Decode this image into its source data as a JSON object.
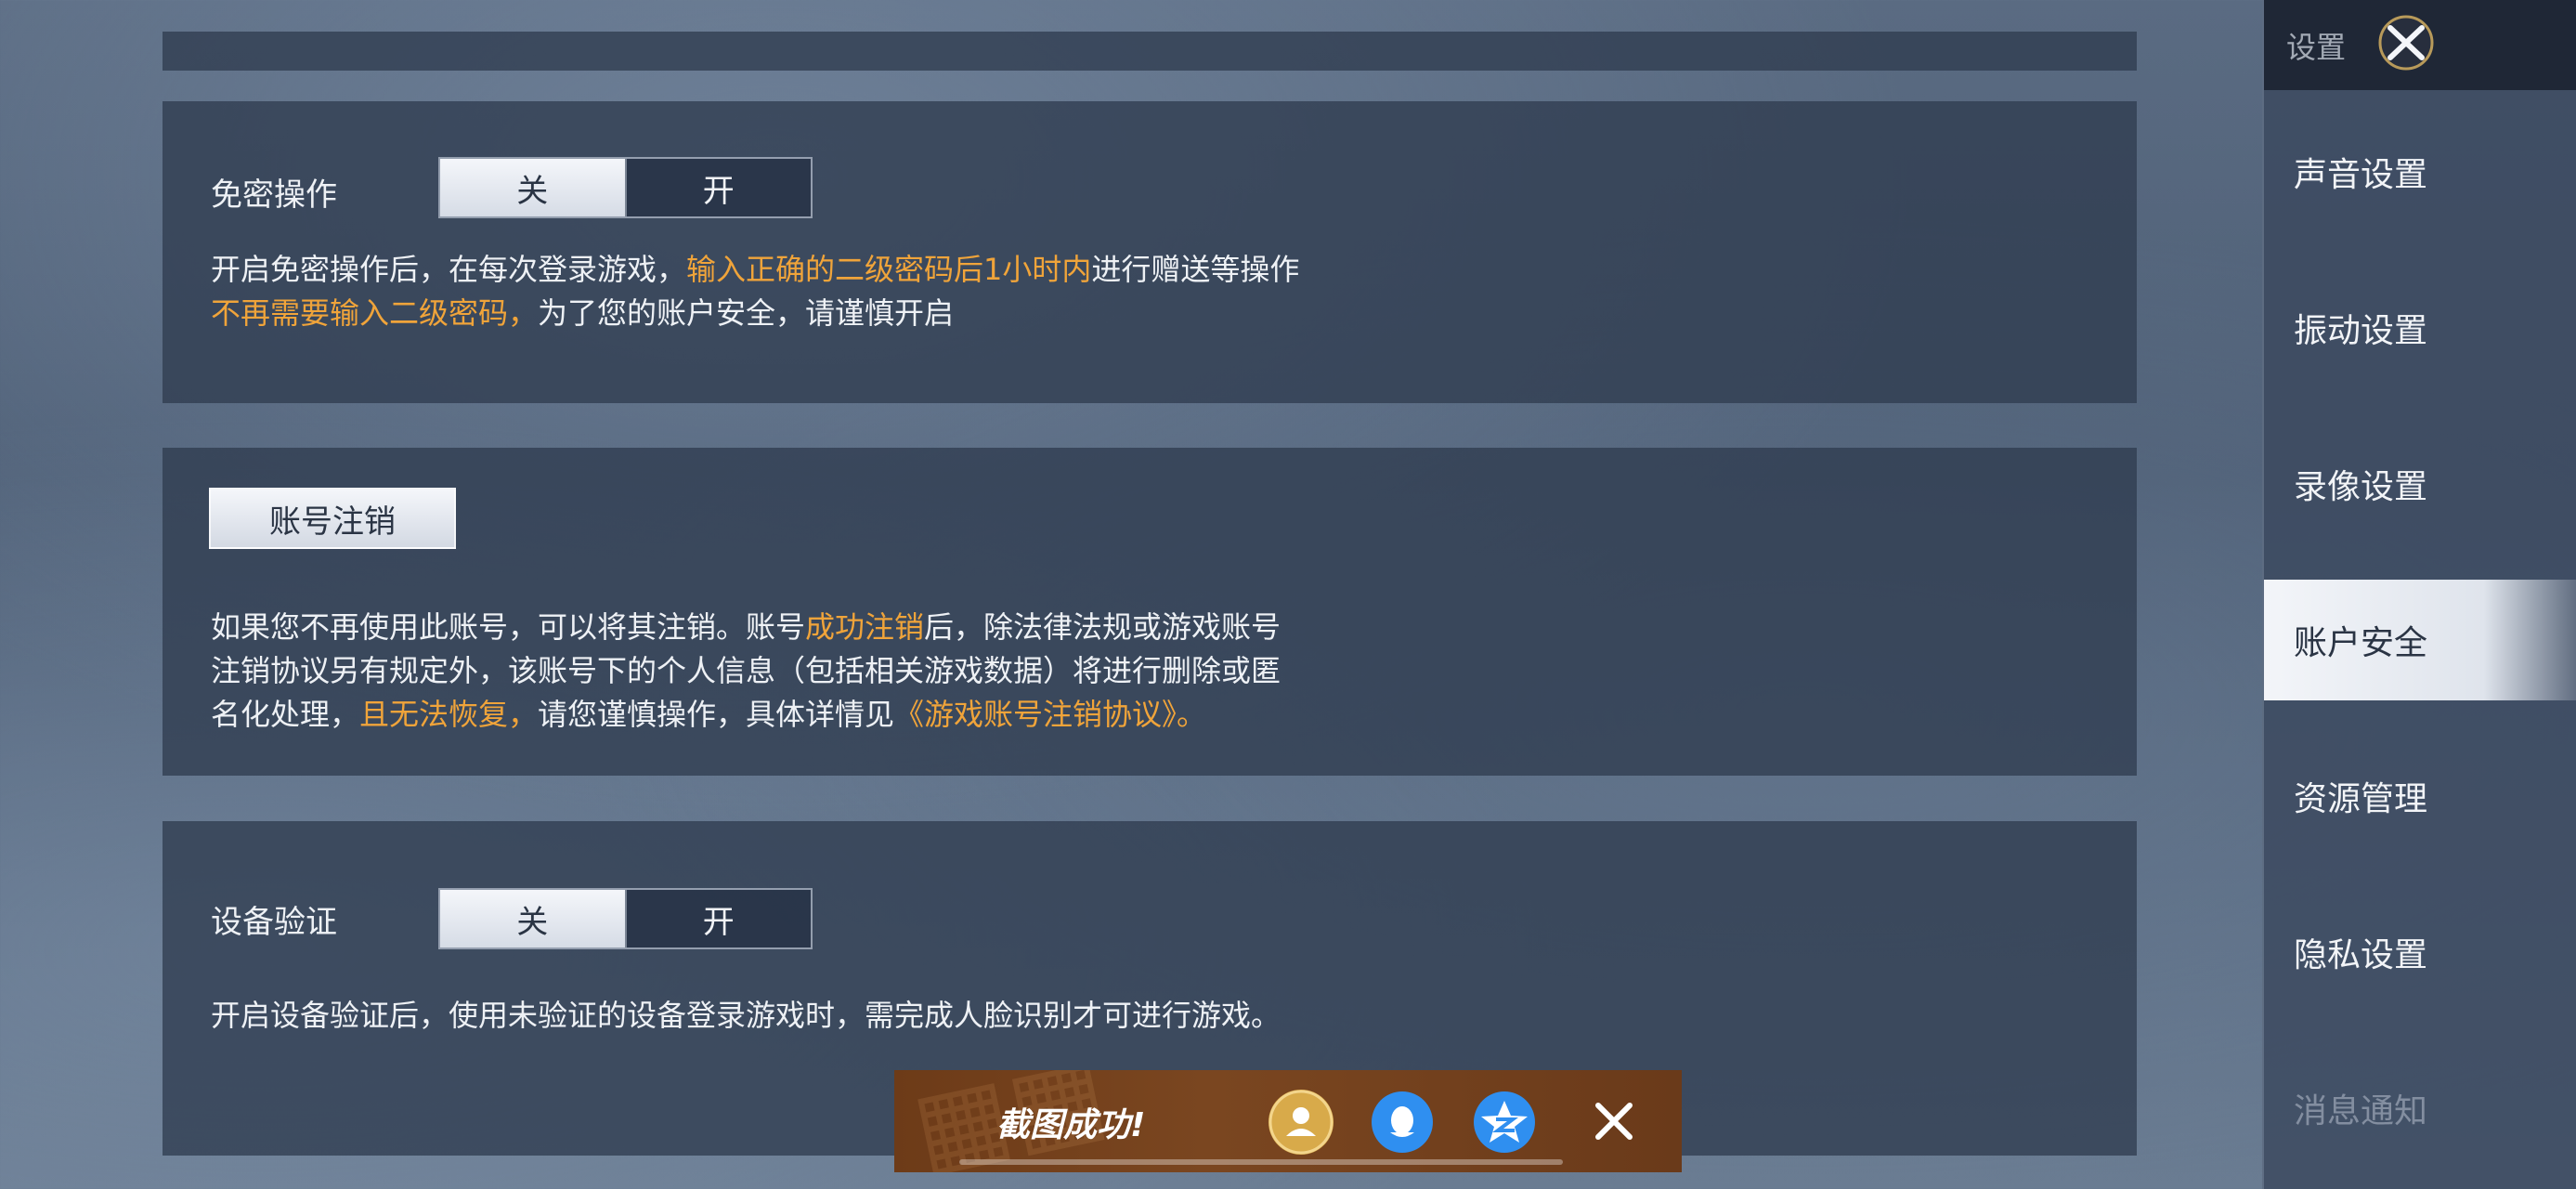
{
  "sidebar": {
    "title": "设置",
    "items": [
      {
        "label": "声音设置"
      },
      {
        "label": "振动设置"
      },
      {
        "label": "录像设置"
      },
      {
        "label": "账户安全"
      },
      {
        "label": "资源管理"
      },
      {
        "label": "隐私设置"
      },
      {
        "label": "消息通知"
      }
    ],
    "active": "账户安全"
  },
  "password_free": {
    "label": "免密操作",
    "toggle": {
      "off_label": "关",
      "on_label": "开",
      "selected": "关"
    },
    "desc": {
      "line1_a": "开启免密操作后，在每次登录游戏，",
      "line1_hl": "输入正确的二级密码后1小时内",
      "line1_b": "进行赠送等操作",
      "line2_hl": "不再需要输入二级密码，",
      "line2_b": "为了您的账户安全，请谨慎开启"
    }
  },
  "account_cancel": {
    "button_label": "账号注销",
    "desc": {
      "line1_a": "如果您不再使用此账号，可以将其注销。账号",
      "line1_hl": "成功注销",
      "line1_b": "后，除法律法规或游戏账号",
      "line2": "注销协议另有规定外，该账号下的个人信息（包括相关游戏数据）将进行删除或匿",
      "line3_a": "名化处理，",
      "line3_hl": "且无法恢复，",
      "line3_b": "请您谨慎操作，具体详情见",
      "line3_link": "《游戏账号注销协议》。"
    }
  },
  "device_verify": {
    "label": "设备验证",
    "toggle": {
      "off_label": "关",
      "on_label": "开",
      "selected": "关"
    },
    "desc": "开启设备验证后，使用未验证的设备登录游戏时，需完成人脸识别才可进行游戏。"
  },
  "toast": {
    "text": "截图成功!",
    "share_icons": [
      "friends-icon",
      "qq-icon",
      "qzone-icon"
    ]
  },
  "colors": {
    "highlight": "#f0a43a",
    "panel": "#303c50",
    "toast_bg": "#7a4620"
  }
}
